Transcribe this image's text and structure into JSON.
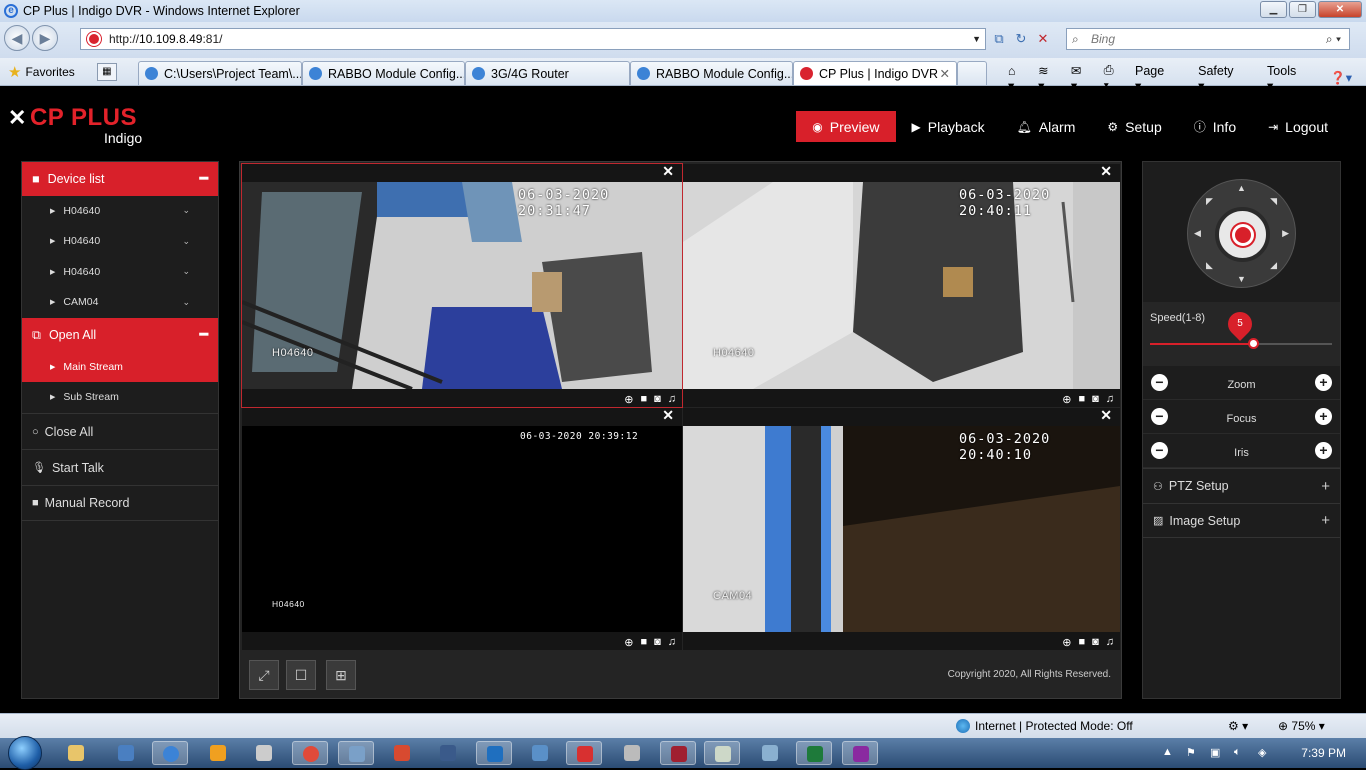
{
  "window": {
    "title": "CP Plus | Indigo DVR - Windows Internet Explorer"
  },
  "address": {
    "prefix": "http://",
    "host": "10.109.8.49",
    "suffix": ":81/"
  },
  "search": {
    "placeholder": "Bing"
  },
  "favorites": {
    "label": "Favorites"
  },
  "tabs": [
    {
      "label": "C:\\Users\\Project Team\\..."
    },
    {
      "label": "RABBO Module Config..."
    },
    {
      "label": "3G/4G Router"
    },
    {
      "label": "RABBO Module Config..."
    },
    {
      "label": "CP Plus | Indigo DVR"
    }
  ],
  "commands": {
    "page": "Page",
    "safety": "Safety",
    "tools": "Tools"
  },
  "app": {
    "logo_text": "CP PLUS",
    "logo_sub": "Indigo",
    "nav": {
      "preview": "Preview",
      "playback": "Playback",
      "alarm": "Alarm",
      "setup": "Setup",
      "info": "Info",
      "logout": "Logout"
    }
  },
  "left": {
    "device_list": "Device list",
    "devices": [
      "H04640",
      "H04640",
      "H04640",
      "CAM04"
    ],
    "open_all": "Open All",
    "main_stream": "Main Stream",
    "sub_stream": "Sub Stream",
    "close_all": "Close All",
    "start_talk": "Start Talk",
    "manual_record": "Manual Record"
  },
  "cameras": [
    {
      "timestamp": "06-03-2020 20:31:47",
      "name": "H04640"
    },
    {
      "timestamp": "06-03-2020 20:40:11",
      "name": "H04640"
    },
    {
      "timestamp": "06-03-2020 20:39:12",
      "name": "H04640"
    },
    {
      "timestamp": "06-03-2020 20:40:10",
      "name": "CAM04"
    }
  ],
  "copyright": "Copyright 2020, All Rights Reserved.",
  "ptz": {
    "speed_label": "Speed(1-8)",
    "speed_value": "5",
    "speed_fraction": 0.57,
    "zoom": "Zoom",
    "focus": "Focus",
    "iris": "Iris",
    "ptz_setup": "PTZ Setup",
    "image_setup": "Image Setup"
  },
  "status": {
    "zone": "Internet | Protected Mode: Off",
    "zoom": "75%"
  },
  "taskbar": {
    "clock": "7:39 PM"
  },
  "colors": {
    "accent": "#d8202a",
    "panel": "#1d1d1d"
  }
}
